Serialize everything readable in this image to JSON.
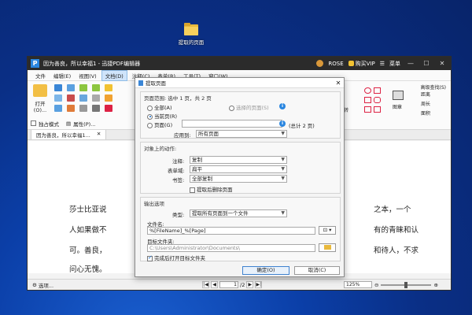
{
  "desktop": {
    "folder_label": "提取的页面"
  },
  "app": {
    "title": "因为善良，所以幸福1 - 迅捷PDF编辑器",
    "user": "ROSE",
    "vip": "购买VIP",
    "menu_label": "菜单",
    "menu": [
      "文件",
      "编辑(E)",
      "视图(V)",
      "文档(D)",
      "注释(C)",
      "表单(R)",
      "工具(T)",
      "窗口(W)"
    ],
    "active_menu": "文档(D)",
    "ribbon": {
      "open_label": "打开(O)...",
      "advanced_search": "高级查找(S)",
      "rotate_label": "旋转",
      "shape_label": "图章",
      "tools": [
        "距离",
        "周长",
        "面积"
      ],
      "sub_items": [
        "独占模式",
        "属性(P)..."
      ]
    },
    "doc_tab": "因为善良，所以幸福1...",
    "doc_lines": [
      {
        "left": "莎士比亚说",
        "right": "之本，一个"
      },
      {
        "left": "人如果做不",
        "right": "有的青睐和认"
      },
      {
        "left": "可。善良，",
        "right": "和待人，不求"
      },
      {
        "left": "问心无愧。",
        "right": ""
      }
    ],
    "status": {
      "options": "选项...",
      "page_value": "1",
      "page_total": "/2",
      "zoom": "125%"
    }
  },
  "dialog": {
    "title": "提取页面",
    "range_header": "页面范围: 选中 1 页，共 2 页",
    "radio_all": "全部(A)",
    "radio_selected": "选择的页面(S)",
    "radio_current": "当前页(R)",
    "radio_pages": "页面(G)",
    "pages_total": "(总计 2 页)",
    "apply_label": "应用到:",
    "apply_value": "所有页面",
    "actions_header": "对象上的动作:",
    "annot_label": "注释:",
    "annot_value": "复制",
    "form_label": "表单域:",
    "form_value": "扁平",
    "bookmark_label": "书签:",
    "bookmark_value": "全部复制",
    "delete_after": "提取后删除页面",
    "output_header": "输出选项",
    "type_label": "类型:",
    "type_value": "提取所有页面到一个文件",
    "filename_label": "文件名:",
    "filename_value": "%[FileName]_%[Page]",
    "folder_label": "目标文件夹:",
    "folder_value": "C:\\Users\\Administrator\\Documents\\",
    "open_after": "完成后打开目标文件夹",
    "ok": "确定(O)",
    "cancel": "取消(C)"
  }
}
